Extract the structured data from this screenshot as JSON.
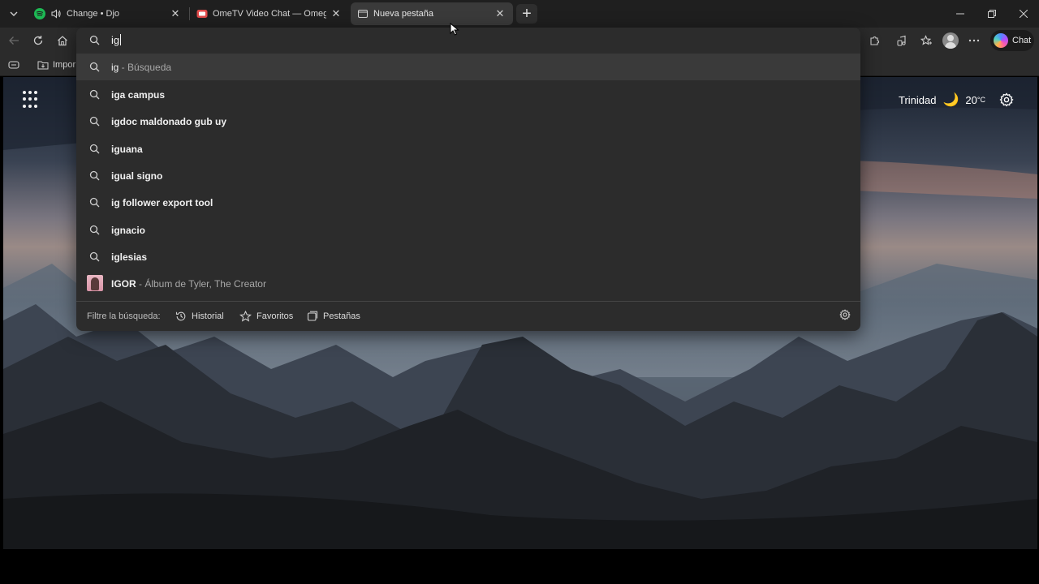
{
  "tabs": [
    {
      "title": "Change • Djo",
      "favicon": "spotify-icon",
      "audio": "speaker-icon",
      "active": false
    },
    {
      "title": "OmeTV Video Chat — Omegle Ra",
      "favicon": "ometv-icon",
      "active": false
    },
    {
      "title": "Nueva pestaña",
      "favicon": "newtab-page-icon",
      "active": true
    }
  ],
  "favorites_bar": {
    "items": [
      {
        "label": "Impor"
      }
    ]
  },
  "omnibox": {
    "query": "ig",
    "suggestions": [
      {
        "main": "ig",
        "suffix": " - Búsqueda",
        "icon": "search-icon"
      },
      {
        "main": "iga campus",
        "suffix": "",
        "icon": "search-icon"
      },
      {
        "main": "igdoc maldonado gub uy",
        "suffix": "",
        "icon": "search-icon"
      },
      {
        "main": "iguana",
        "suffix": "",
        "icon": "search-icon"
      },
      {
        "main": "igual signo",
        "suffix": "",
        "icon": "search-icon"
      },
      {
        "main": "ig follower export tool",
        "suffix": "",
        "icon": "search-icon"
      },
      {
        "main": "ignacio",
        "suffix": "",
        "icon": "search-icon"
      },
      {
        "main": "iglesias",
        "suffix": "",
        "icon": "search-icon"
      },
      {
        "main": "IGOR",
        "suffix": " - Álbum de Tyler, The Creator",
        "icon": "album-thumbnail"
      }
    ],
    "filter": {
      "label": "Filtre la búsqueda:",
      "chips": [
        "Historial",
        "Favoritos",
        "Pestañas"
      ]
    }
  },
  "toolbar": {
    "chat_label": "Chat"
  },
  "ntp": {
    "weather": {
      "location": "Trinidad",
      "temperature": "20",
      "unit": "°C",
      "icon": "moon-icon"
    }
  },
  "colors": {
    "accent_moon": "#f5c542",
    "tab_active_bg": "#3a3a3a",
    "dropdown_bg": "#2c2c2c"
  }
}
